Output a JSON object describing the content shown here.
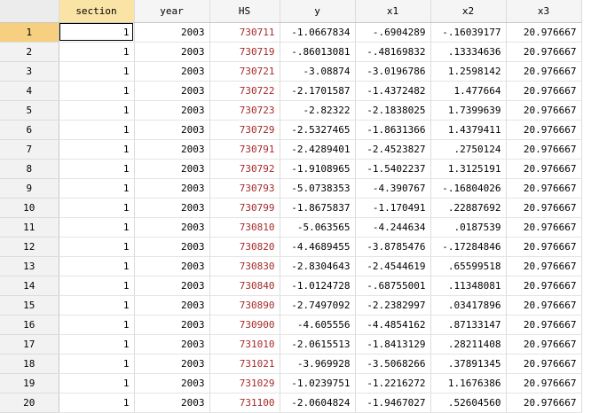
{
  "columns": [
    "section",
    "year",
    "HS",
    "y",
    "x1",
    "x2",
    "x3"
  ],
  "selected_cell": {
    "row": "1",
    "column": "section"
  },
  "colors": {
    "hs_text": "#a52a2a",
    "active_header": "#f9e4a6",
    "active_row_header": "#f7cf80"
  },
  "rows": [
    {
      "n": "1",
      "cells": [
        "1",
        "2003",
        "730711",
        "-1.0667834",
        "-.6904289",
        "-.16039177",
        "20.976667"
      ]
    },
    {
      "n": "2",
      "cells": [
        "1",
        "2003",
        "730719",
        "-.86013081",
        "-.48169832",
        ".13334636",
        "20.976667"
      ]
    },
    {
      "n": "3",
      "cells": [
        "1",
        "2003",
        "730721",
        "-3.08874",
        "-3.0196786",
        "1.2598142",
        "20.976667"
      ]
    },
    {
      "n": "4",
      "cells": [
        "1",
        "2003",
        "730722",
        "-2.1701587",
        "-1.4372482",
        "1.477664",
        "20.976667"
      ]
    },
    {
      "n": "5",
      "cells": [
        "1",
        "2003",
        "730723",
        "-2.82322",
        "-2.1838025",
        "1.7399639",
        "20.976667"
      ]
    },
    {
      "n": "6",
      "cells": [
        "1",
        "2003",
        "730729",
        "-2.5327465",
        "-1.8631366",
        "1.4379411",
        "20.976667"
      ]
    },
    {
      "n": "7",
      "cells": [
        "1",
        "2003",
        "730791",
        "-2.4289401",
        "-2.4523827",
        ".2750124",
        "20.976667"
      ]
    },
    {
      "n": "8",
      "cells": [
        "1",
        "2003",
        "730792",
        "-1.9108965",
        "-1.5402237",
        "1.3125191",
        "20.976667"
      ]
    },
    {
      "n": "9",
      "cells": [
        "1",
        "2003",
        "730793",
        "-5.0738353",
        "-4.390767",
        "-.16804026",
        "20.976667"
      ]
    },
    {
      "n": "10",
      "cells": [
        "1",
        "2003",
        "730799",
        "-1.8675837",
        "-1.170491",
        ".22887692",
        "20.976667"
      ]
    },
    {
      "n": "11",
      "cells": [
        "1",
        "2003",
        "730810",
        "-5.063565",
        "-4.244634",
        ".0187539",
        "20.976667"
      ]
    },
    {
      "n": "12",
      "cells": [
        "1",
        "2003",
        "730820",
        "-4.4689455",
        "-3.8785476",
        "-.17284846",
        "20.976667"
      ]
    },
    {
      "n": "13",
      "cells": [
        "1",
        "2003",
        "730830",
        "-2.8304643",
        "-2.4544619",
        ".65599518",
        "20.976667"
      ]
    },
    {
      "n": "14",
      "cells": [
        "1",
        "2003",
        "730840",
        "-1.0124728",
        "-.68755001",
        ".11348081",
        "20.976667"
      ]
    },
    {
      "n": "15",
      "cells": [
        "1",
        "2003",
        "730890",
        "-2.7497092",
        "-2.2382997",
        ".03417896",
        "20.976667"
      ]
    },
    {
      "n": "16",
      "cells": [
        "1",
        "2003",
        "730900",
        "-4.605556",
        "-4.4854162",
        ".87133147",
        "20.976667"
      ]
    },
    {
      "n": "17",
      "cells": [
        "1",
        "2003",
        "731010",
        "-2.0615513",
        "-1.8413129",
        ".28211408",
        "20.976667"
      ]
    },
    {
      "n": "18",
      "cells": [
        "1",
        "2003",
        "731021",
        "-3.969928",
        "-3.5068266",
        ".37891345",
        "20.976667"
      ]
    },
    {
      "n": "19",
      "cells": [
        "1",
        "2003",
        "731029",
        "-1.0239751",
        "-1.2216272",
        "1.1676386",
        "20.976667"
      ]
    },
    {
      "n": "20",
      "cells": [
        "1",
        "2003",
        "731100",
        "-2.0604824",
        "-1.9467027",
        ".52604560",
        "20.976667"
      ]
    }
  ]
}
